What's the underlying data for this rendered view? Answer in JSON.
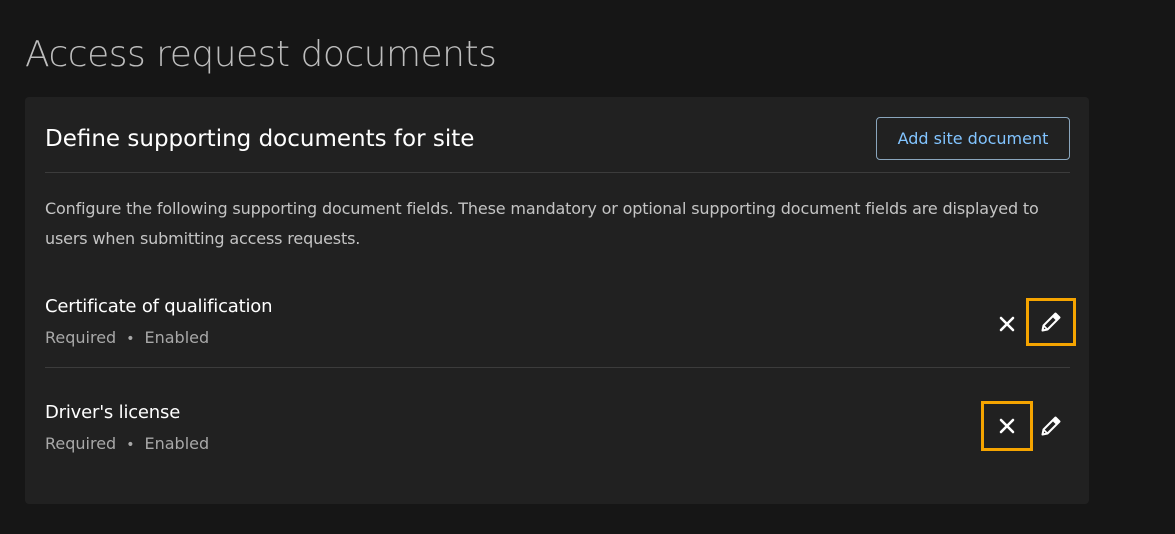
{
  "page": {
    "title": "Access request documents"
  },
  "card": {
    "title": "Define supporting documents for site",
    "add_button_label": "Add site document",
    "description": "Configure the following supporting document fields. These mandatory or optional supporting document fields are displayed to users when submitting access requests."
  },
  "documents": [
    {
      "name": "Certificate of qualification",
      "requirement": "Required",
      "separator": "•",
      "status": "Enabled",
      "highlighted_action": "edit"
    },
    {
      "name": "Driver's license",
      "requirement": "Required",
      "separator": "•",
      "status": "Enabled",
      "highlighted_action": "delete"
    }
  ],
  "icons": {
    "delete": "close-icon",
    "edit": "pencil-icon"
  },
  "colors": {
    "background": "#161616",
    "card": "#212121",
    "accent": "#82c4ff",
    "highlight": "#f5a400"
  }
}
